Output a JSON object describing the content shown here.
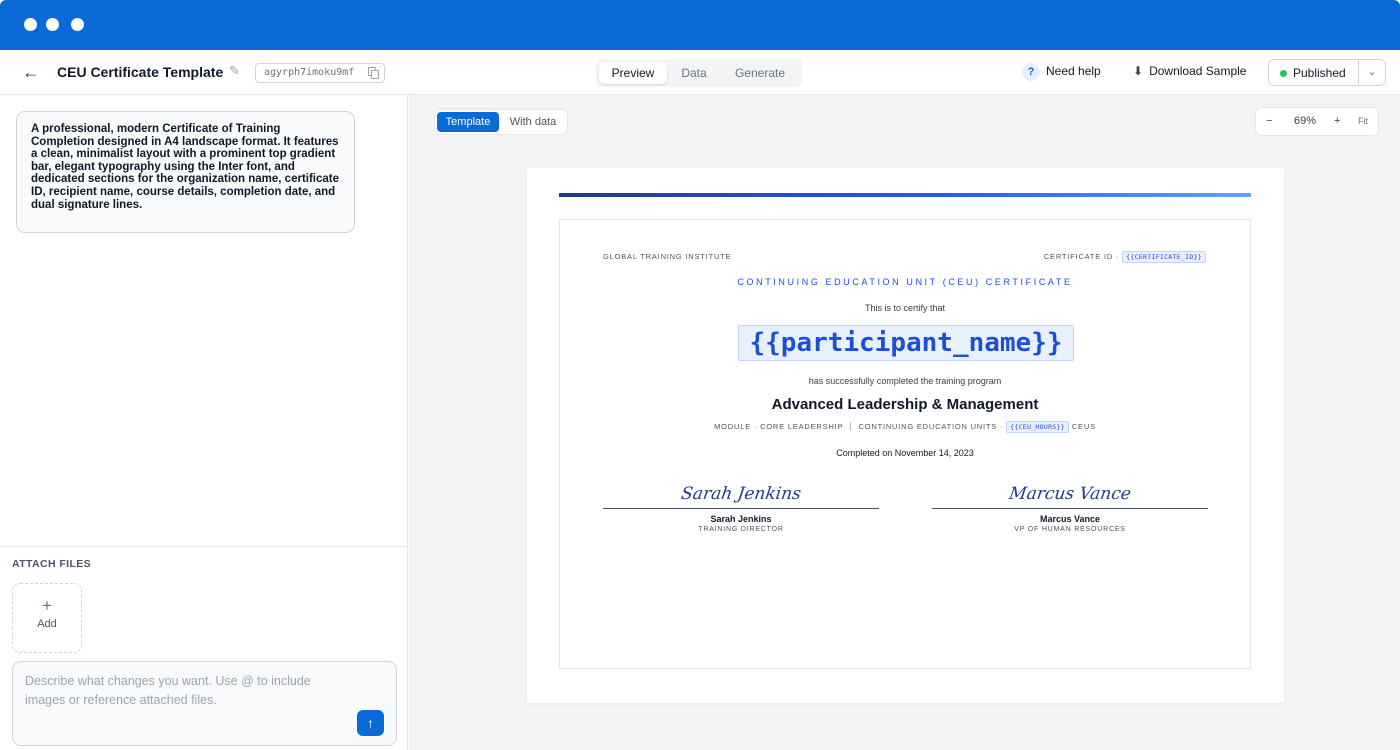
{
  "header": {
    "title": "CEU Certificate Template",
    "template_id": "agyrph7imoku9mf",
    "tabs": [
      {
        "label": "Preview"
      },
      {
        "label": "Data"
      },
      {
        "label": "Generate"
      }
    ],
    "active_tab": "Preview",
    "help_label": "Need help",
    "download_label": "Download Sample",
    "status_label": "Published",
    "status_color": "#22c55e",
    "accent_color": "#0a6bd8"
  },
  "left_panel": {
    "prompt_text": "A professional, modern Certificate of Training Completion designed in A4 landscape format. It features a clean, minimalist layout with a prominent top gradient bar, elegant typography using the Inter font, and dedicated sections for the organization name, certificate ID, recipient name, course details, completion date, and dual signature lines.",
    "attach_title": "ATTACH FILES",
    "add_label": "Add",
    "compose_placeholder": "Describe what changes you want. Use @ to include images or reference attached files."
  },
  "canvas": {
    "modes": [
      {
        "label": "Template"
      },
      {
        "label": "With data"
      }
    ],
    "active_mode": "Template",
    "zoom_level": "69%",
    "zoom_out": "−",
    "zoom_in": "+",
    "fit_label": "Fit"
  },
  "certificate": {
    "organization": "GLOBAL TRAINING INSTITUTE",
    "certificate_id_label": "CERTIFICATE ID ·",
    "certificate_id_var": "{{CERTIFICATE_ID}}",
    "heading": "CONTINUING EDUCATION UNIT (CEU) CERTIFICATE",
    "certify_text": "This is to certify that",
    "participant_var": "{{participant_name}}",
    "completed_text": "has successfully completed the training program",
    "course_title": "Advanced Leadership & Management",
    "module_text": "MODULE · CORE LEADERSHIP",
    "ceu_label": "CONTINUING EDUCATION UNITS ·",
    "ceu_var": "{{CEU_HOURS}}",
    "ceu_suffix": "CEUS",
    "completion_date": "Completed on November 14, 2023",
    "signatures": [
      {
        "script": "Sarah Jenkins",
        "name": "Sarah Jenkins",
        "role": "TRAINING DIRECTOR"
      },
      {
        "script": "Marcus Vance",
        "name": "Marcus Vance",
        "role": "VP OF HUMAN RESOURCES"
      }
    ]
  }
}
